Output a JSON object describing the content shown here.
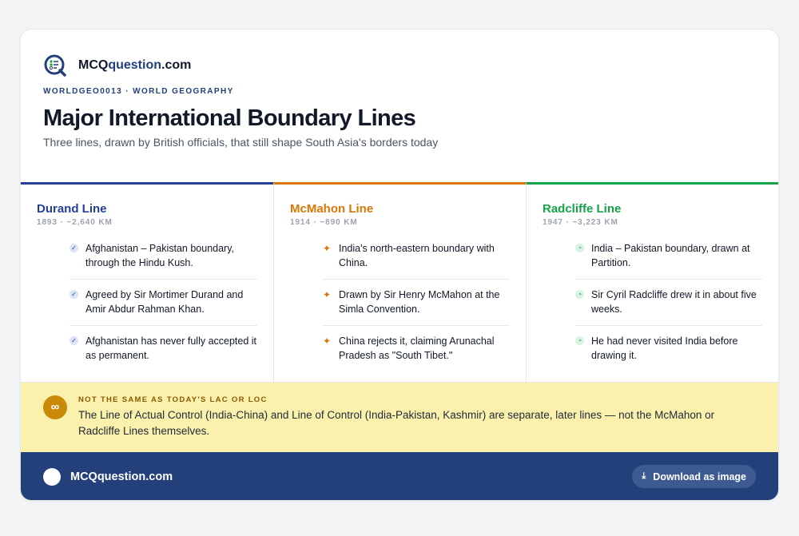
{
  "brand": {
    "name_prefix": "MCQ",
    "name_accent": "question",
    "name_suffix": ".com"
  },
  "kicker": "WORLDGEO0013 · WORLD GEOGRAPHY",
  "title": "Major International Boundary Lines",
  "subtitle": "Three lines, drawn by British officials, that still shape South Asia's borders today",
  "columns": [
    {
      "name": "Durand Line",
      "meta": "1893 · ~2,640 KM",
      "color": "#23409a",
      "icon": "check-circle-icon",
      "items": [
        "Afghanistan – Pakistan boundary, through the Hindu Kush.",
        "Agreed by Sir Mortimer Durand and Amir Abdur Rahman Khan.",
        "Afghanistan has never fully accepted it as permanent."
      ]
    },
    {
      "name": "McMahon Line",
      "meta": "1914 · ~890 KM",
      "color": "#d97706",
      "icon": "sparkle-icon",
      "items": [
        "India's north-eastern boundary with China.",
        "Drawn by Sir Henry McMahon at the Simla Convention.",
        "China rejects it, claiming Arunachal Pradesh as \"South Tibet.\""
      ]
    },
    {
      "name": "Radcliffe Line",
      "meta": "1947 · ~3,223 KM",
      "color": "#16a34a",
      "icon": "clock-icon",
      "items": [
        "India – Pakistan boundary, drawn at Partition.",
        "Sir Cyril Radcliffe drew it in about five weeks.",
        "He had never visited India before drawing it."
      ]
    }
  ],
  "note": {
    "badge": "∞",
    "title": "NOT THE SAME AS TODAY'S LAC OR LOC",
    "text": "The Line of Actual Control (India-China) and Line of Control (India-Pakistan, Kashmir) are separate, later lines — not the McMahon or Radcliffe Lines themselves."
  },
  "footer": {
    "brand": "MCQquestion.com",
    "download_label": "Download as image",
    "download_icon": "download-icon"
  }
}
